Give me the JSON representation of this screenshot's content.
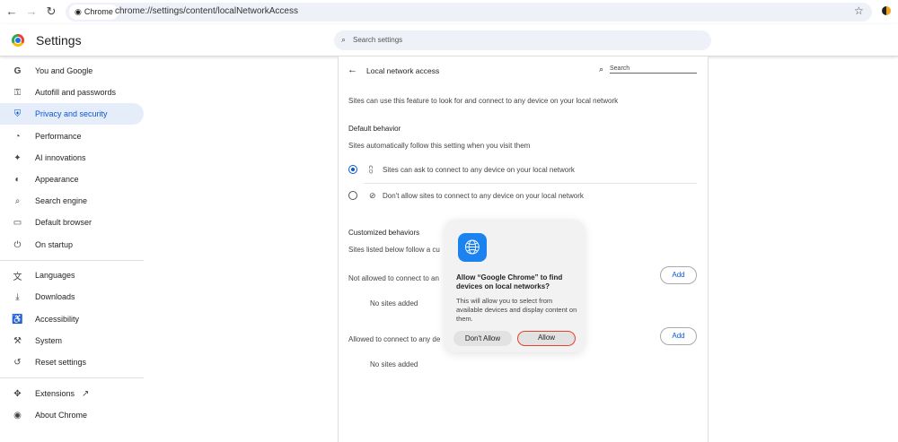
{
  "browser": {
    "chip_label": "Chrome",
    "url": "chrome://settings/content/localNetworkAccess"
  },
  "header": {
    "title": "Settings",
    "search_placeholder": "Search settings"
  },
  "sidebar": {
    "items": [
      {
        "label": "You and Google",
        "icon": "google-icon"
      },
      {
        "label": "Autofill and passwords",
        "icon": "key-icon"
      },
      {
        "label": "Privacy and security",
        "icon": "shield-icon",
        "active": true
      },
      {
        "label": "Performance",
        "icon": "speedometer-icon"
      },
      {
        "label": "AI innovations",
        "icon": "sparkle-icon"
      },
      {
        "label": "Appearance",
        "icon": "palette-icon"
      },
      {
        "label": "Search engine",
        "icon": "search-icon"
      },
      {
        "label": "Default browser",
        "icon": "browser-icon"
      },
      {
        "label": "On startup",
        "icon": "power-icon"
      },
      {
        "label": "Languages",
        "icon": "translate-icon"
      },
      {
        "label": "Downloads",
        "icon": "download-icon"
      },
      {
        "label": "Accessibility",
        "icon": "accessibility-icon"
      },
      {
        "label": "System",
        "icon": "wrench-icon"
      },
      {
        "label": "Reset settings",
        "icon": "reset-icon"
      },
      {
        "label": "Extensions",
        "icon": "puzzle-icon"
      },
      {
        "label": "About Chrome",
        "icon": "chrome-icon"
      }
    ]
  },
  "main": {
    "title": "Local network access",
    "search_placeholder": "Search",
    "description": "Sites can use this feature to look for and connect to any device on your local network",
    "default_heading": "Default behavior",
    "default_sub": "Sites automatically follow this setting when you visit them",
    "options": [
      {
        "label": "Sites can ask to connect to any device on your local network",
        "selected": true
      },
      {
        "label": "Don't allow sites to connect to any device on your local network",
        "selected": false
      }
    ],
    "custom_heading": "Customized behaviors",
    "custom_sub": "Sites listed below follow a cu",
    "not_allowed_label": "Not allowed to connect to an",
    "allowed_label": "Allowed to connect to any de",
    "add_label": "Add",
    "empty": "No sites added"
  },
  "dialog": {
    "title": "Allow “Google Chrome” to find devices on local networks?",
    "body": "This will allow you to select from available devices and display content on them.",
    "deny": "Don't Allow",
    "allow": "Allow",
    "accent": "#e0442c"
  }
}
